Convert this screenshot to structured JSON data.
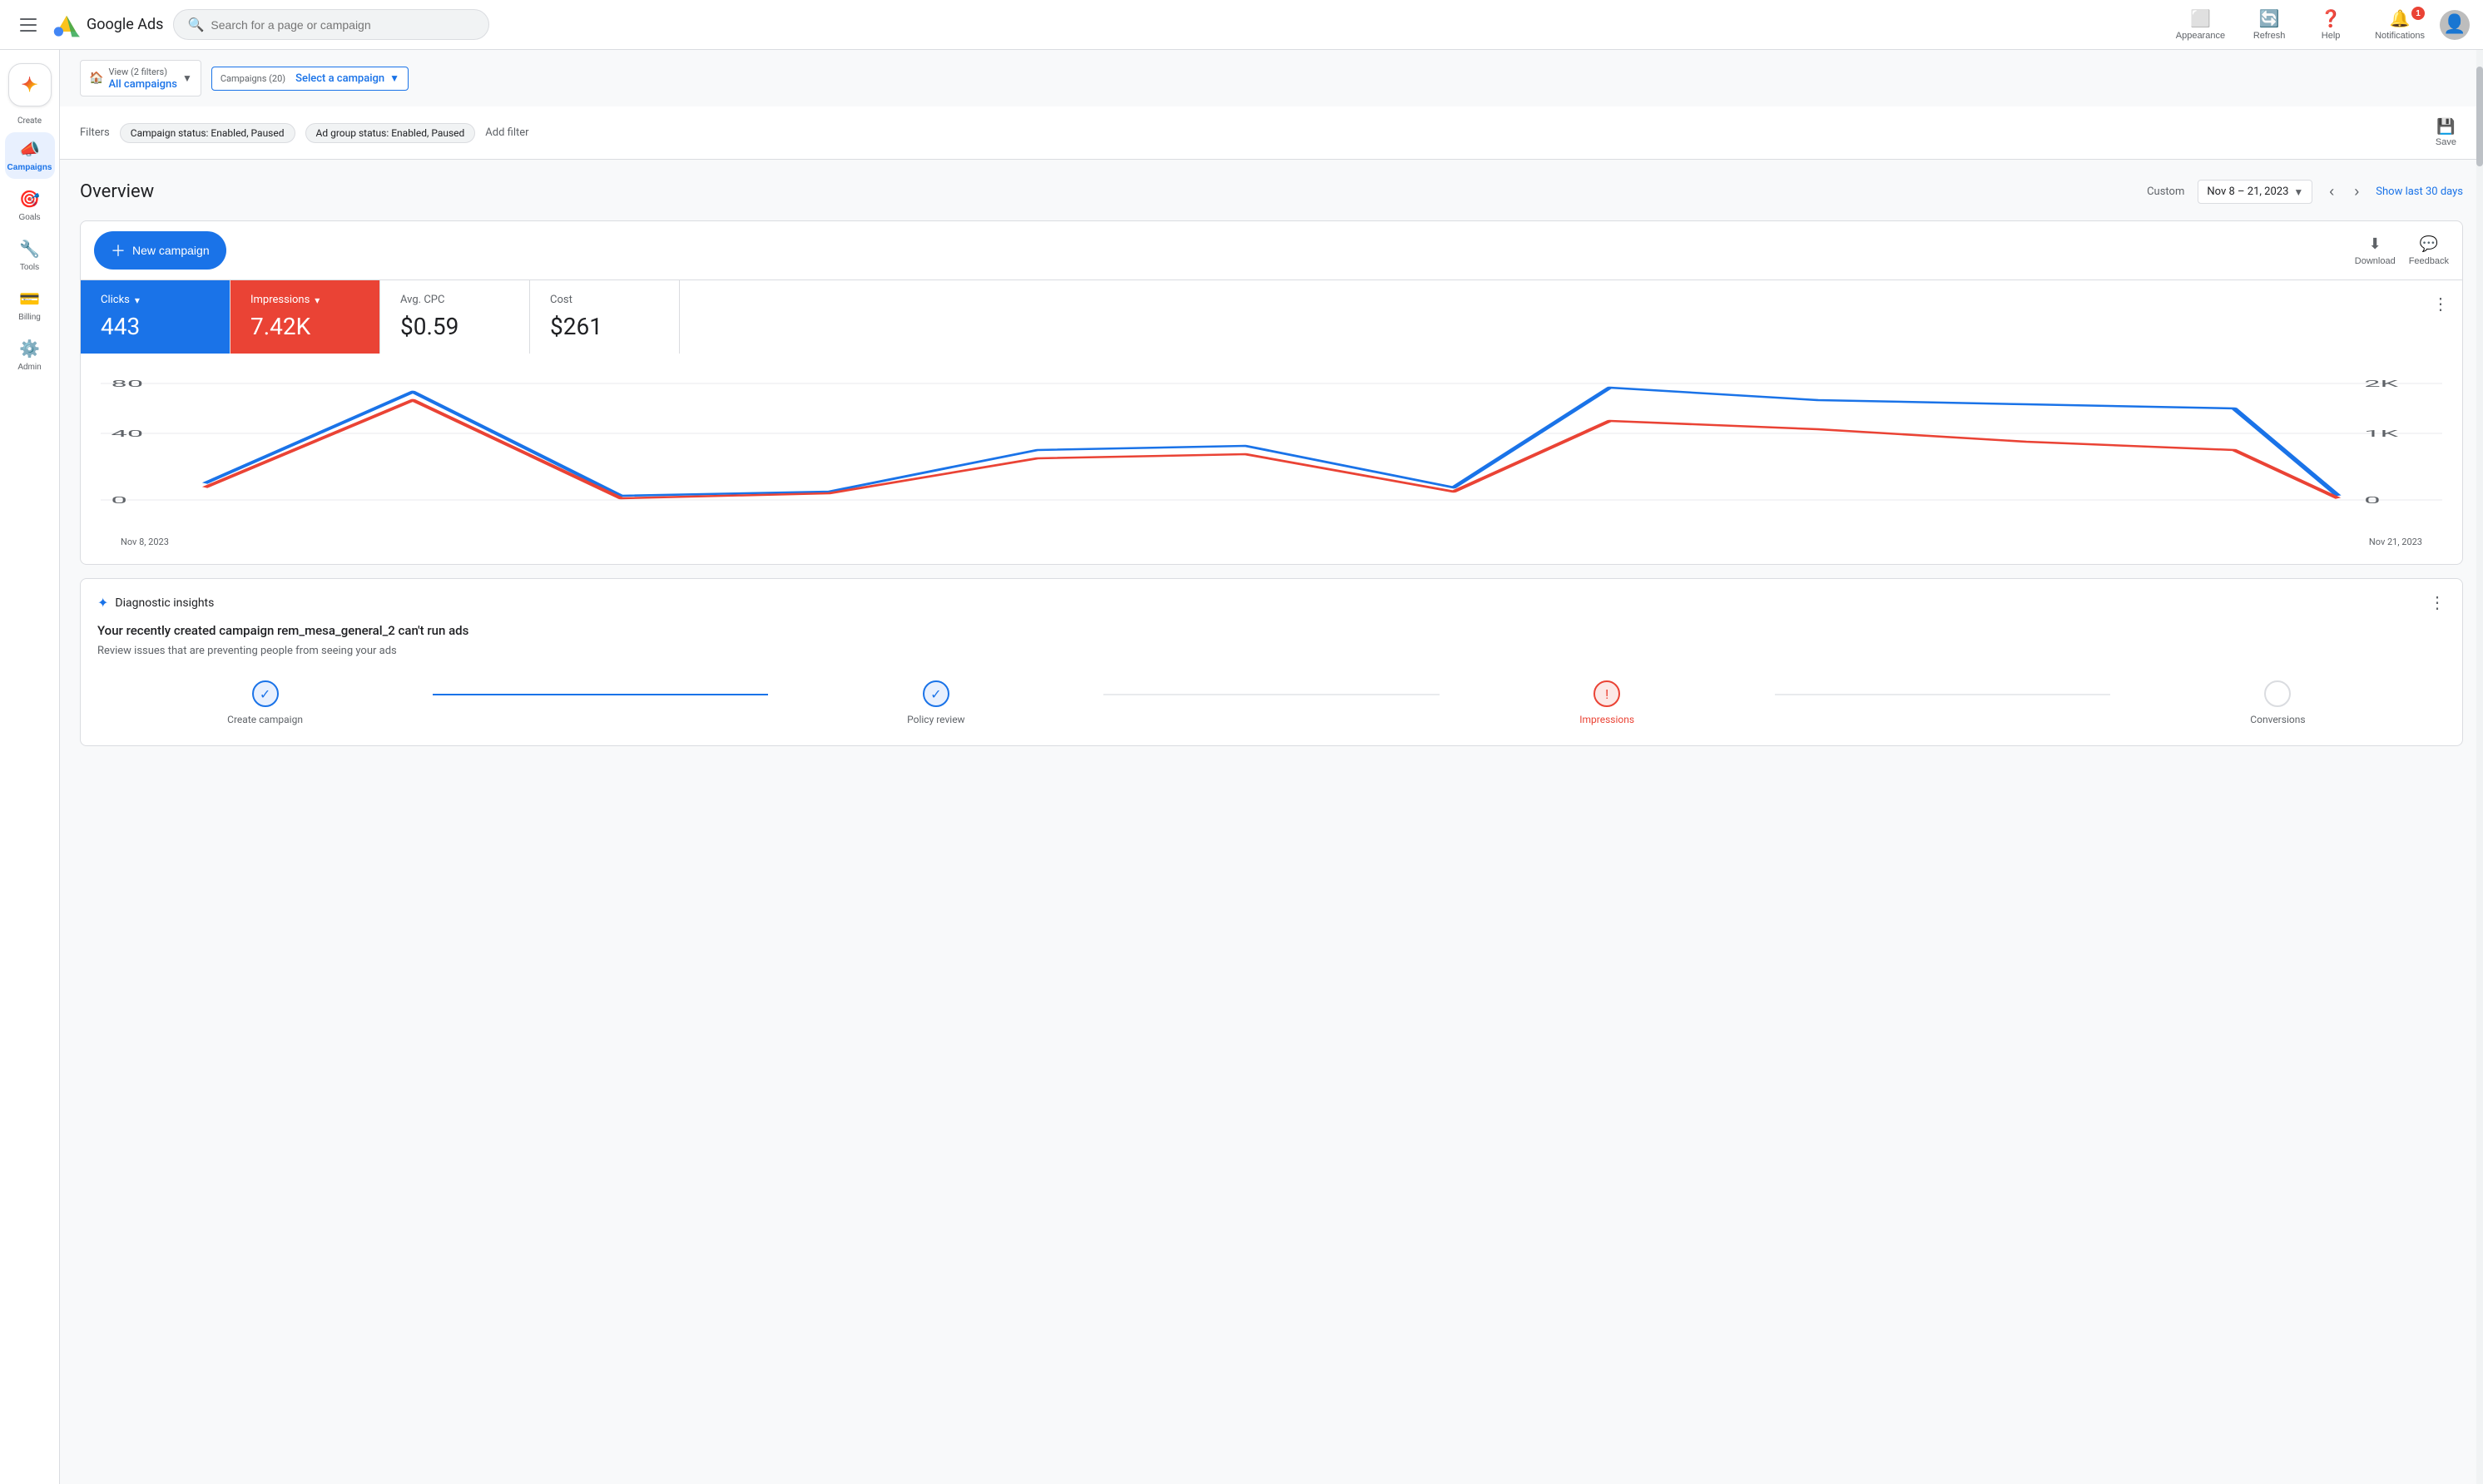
{
  "topnav": {
    "search_placeholder": "Search for a page or campaign",
    "logo_text": "Google Ads",
    "appearance_label": "Appearance",
    "refresh_label": "Refresh",
    "help_label": "Help",
    "notifications_label": "Notifications",
    "notif_count": "1"
  },
  "sidebar": {
    "create_label": "Create",
    "items": [
      {
        "id": "campaigns",
        "label": "Campaigns",
        "icon": "📣",
        "active": true
      },
      {
        "id": "goals",
        "label": "Goals",
        "icon": "🎯",
        "active": false
      },
      {
        "id": "tools",
        "label": "Tools",
        "icon": "🔧",
        "active": false
      },
      {
        "id": "billing",
        "label": "Billing",
        "icon": "💳",
        "active": false
      },
      {
        "id": "admin",
        "label": "Admin",
        "icon": "⚙️",
        "active": false
      }
    ]
  },
  "filterbar": {
    "label": "Filters",
    "chip1": "Campaign status: Enabled, Paused",
    "chip2": "Ad group status: Enabled, Paused",
    "add_filter": "Add filter",
    "save_label": "Save"
  },
  "viewbar": {
    "view_label": "View (2 filters)",
    "all_campaigns": "All campaigns",
    "campaigns_count": "Campaigns (20)",
    "select_campaign": "Select a campaign"
  },
  "overview": {
    "title": "Overview",
    "custom_label": "Custom",
    "date_range": "Nov 8 – 21, 2023",
    "show_30_label": "Show last 30 days",
    "download_label": "Download",
    "feedback_label": "Feedback",
    "new_campaign_label": "New campaign"
  },
  "metrics": {
    "clicks_label": "Clicks",
    "clicks_value": "443",
    "impressions_label": "Impressions",
    "impressions_value": "7.42K",
    "avg_cpc_label": "Avg. CPC",
    "avg_cpc_value": "$0.59",
    "cost_label": "Cost",
    "cost_value": "$261"
  },
  "chart": {
    "y_left_labels": [
      "80",
      "40",
      "0"
    ],
    "y_right_labels": [
      "2K",
      "1K",
      "0"
    ],
    "x_start": "Nov 8, 2023",
    "x_end": "Nov 21, 2023"
  },
  "diagnostic": {
    "section_label": "Diagnostic insights",
    "headline": "Your recently created campaign rem_mesa_general_2 can't run ads",
    "description": "Review issues that are preventing people from seeing your ads",
    "steps": [
      {
        "id": "create",
        "label": "Create campaign",
        "status": "done"
      },
      {
        "id": "policy",
        "label": "Policy review",
        "status": "done"
      },
      {
        "id": "impressions",
        "label": "Impressions",
        "status": "error"
      },
      {
        "id": "conversions",
        "label": "Conversions",
        "status": "empty"
      }
    ]
  }
}
